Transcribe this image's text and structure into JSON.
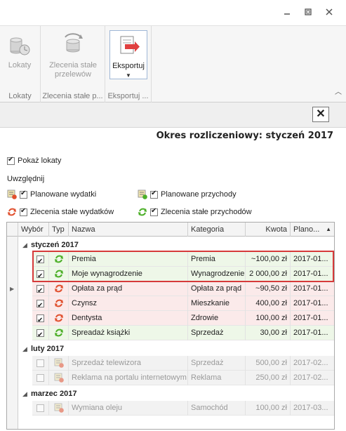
{
  "window": {
    "minimize_icon": "minimize-icon",
    "restore_icon": "restore-icon",
    "close_icon": "close-icon"
  },
  "ribbon": {
    "groups": [
      {
        "button": "Lokaty",
        "label": "Lokaty"
      },
      {
        "button_line1": "Zlecenia stałe",
        "button_line2": "przelewów",
        "label": "Zlecenia stałe p..."
      },
      {
        "button": "Eksportuj",
        "label": "Eksportuj ..."
      }
    ]
  },
  "panel": {
    "close_symbol": "✕",
    "okres": "Okres rozliczeniowy: styczeń 2017"
  },
  "options": {
    "pokaz_lokaty": "Pokaż lokaty",
    "uwzglednij": "Uwzględnij",
    "planowane_wydatki": "Planowane wydatki",
    "planowane_przychody": "Planowane przychody",
    "zlecenia_wydatkow": "Zlecenia stałe wydatków",
    "zlecenia_przychodow": "Zlecenia stałe przychodów"
  },
  "grid": {
    "columns": [
      "Wybór",
      "Typ",
      "Nazwa",
      "Kategoria",
      "Kwota",
      "Plano..."
    ],
    "sort_indicator": "▲",
    "groups": [
      {
        "name": "styczeń 2017",
        "rows": [
          {
            "nazwa": "Premia",
            "kategoria": "Premia",
            "kwota": "~100,00 zł",
            "data": "2017-01...",
            "type": "income"
          },
          {
            "nazwa": "Moje wynagrodzenie",
            "kategoria": "Wynagrodzenie",
            "kwota": "2 000,00 zł",
            "data": "2017-01...",
            "type": "income"
          },
          {
            "nazwa": "Opłata za prąd",
            "kategoria": "Opłata za prąd",
            "kwota": "~90,50 zł",
            "data": "2017-01...",
            "type": "expense"
          },
          {
            "nazwa": "Czynsz",
            "kategoria": "Mieszkanie",
            "kwota": "400,00 zł",
            "data": "2017-01...",
            "type": "expense"
          },
          {
            "nazwa": "Dentysta",
            "kategoria": "Zdrowie",
            "kwota": "100,00 zł",
            "data": "2017-01...",
            "type": "expense"
          },
          {
            "nazwa": "Spreadaż książki",
            "kategoria": "Sprzedaż",
            "kwota": "30,00 zł",
            "data": "2017-01...",
            "type": "income"
          }
        ]
      },
      {
        "name": "luty 2017",
        "rows": [
          {
            "nazwa": "Sprzedaż telewizora",
            "kategoria": "Sprzedaż",
            "kwota": "500,00 zł",
            "data": "2017-02..."
          },
          {
            "nazwa": "Reklama na portalu internetowym",
            "kategoria": "Reklama",
            "kwota": "250,00 zł",
            "data": "2017-02..."
          }
        ]
      },
      {
        "name": "marzec 2017",
        "rows": [
          {
            "nazwa": "Wymiana oleju",
            "kategoria": "Samochód",
            "kwota": "100,00 zł",
            "data": "2017-03..."
          }
        ]
      }
    ]
  },
  "colors": {
    "income_icon": "#4caf28",
    "expense_icon": "#e0502e",
    "highlight": "#d63a3a"
  }
}
